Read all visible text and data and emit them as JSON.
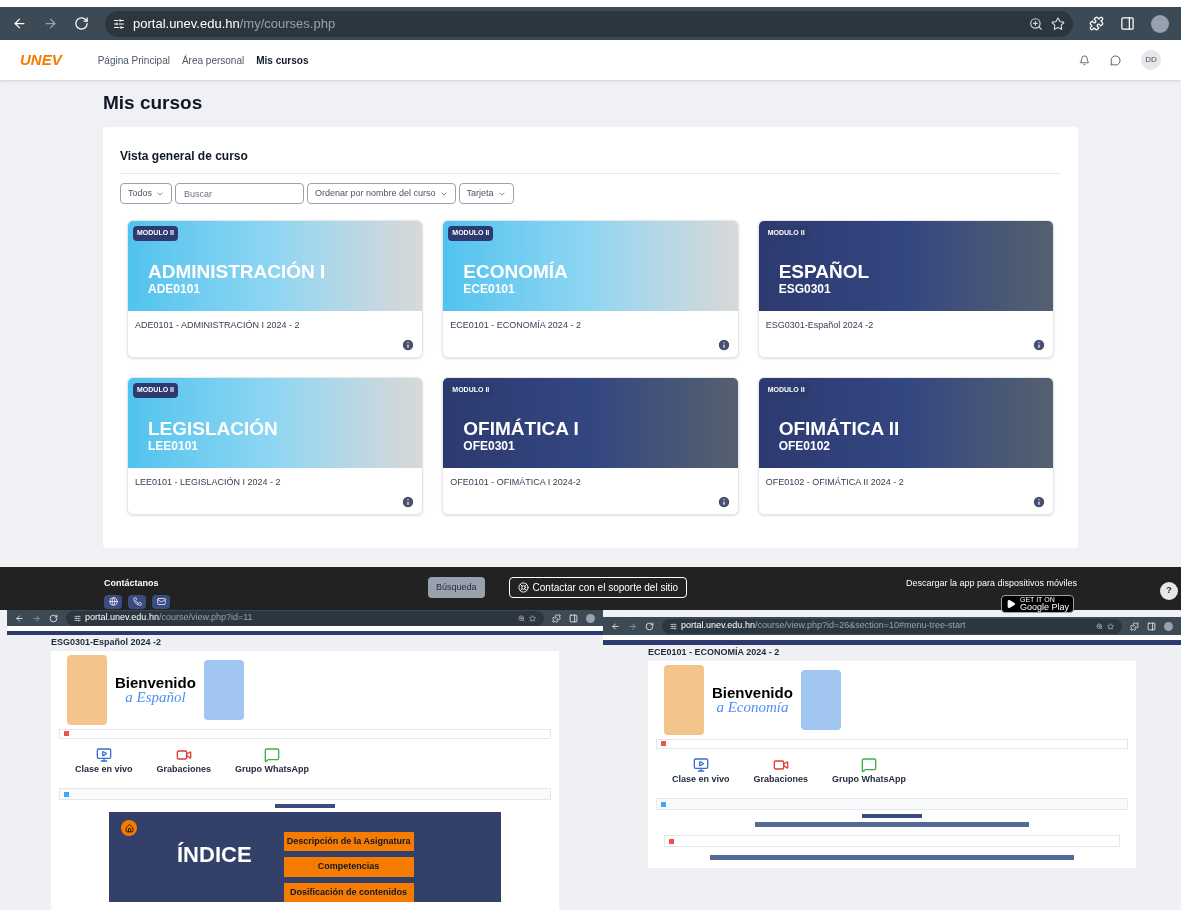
{
  "browser": {
    "url_host": "portal.unev.edu.hn",
    "url_path": "/my/courses.php"
  },
  "navbar": {
    "logo": "UNEV",
    "items": [
      {
        "label": "Página Principal",
        "selected": false
      },
      {
        "label": "Área personal",
        "selected": false
      },
      {
        "label": "Mis cursos",
        "selected": true
      }
    ],
    "avatar": "DD"
  },
  "page_title": "Mis cursos",
  "overview": {
    "title": "Vista general de curso",
    "filters": [
      {
        "kind": "dropdown",
        "label": "Todos"
      },
      {
        "kind": "search",
        "placeholder": "Buscar"
      },
      {
        "kind": "dropdown",
        "label": "Ordenar por nombre del curso"
      },
      {
        "kind": "dropdown",
        "label": "Tarjeta"
      }
    ],
    "courses": [
      {
        "badge": "MODULO II",
        "kind": "light",
        "title": "ADMINISTRACIÓN I",
        "code": "ADE0101",
        "name": "ADE0101 - ADMINISTRACIÓN I 2024 - 2"
      },
      {
        "badge": "MODULO II",
        "kind": "light",
        "title": "ECONOMÍA",
        "code": "ECE0101",
        "name": "ECE0101 - ECONOMÍA 2024 - 2"
      },
      {
        "badge": "MODULO II",
        "kind": "dark",
        "title": "ESPAÑOL",
        "code": "ESG0301",
        "name": "ESG0301-Español 2024 -2"
      },
      {
        "badge": "MODULO II",
        "kind": "light",
        "title": "LEGISLACIÓN",
        "code": "LEE0101",
        "name": "LEE0101 - LEGISLACIÓN I 2024 - 2"
      },
      {
        "badge": "MODULO II",
        "kind": "dark",
        "title": "OFIMÁTICA I",
        "code": "OFE0301",
        "name": "OFE0101 - OFIMÁTICA I 2024-2"
      },
      {
        "badge": "MODULO II",
        "kind": "dark",
        "title": "OFIMÁTICA II",
        "code": "OFE0102",
        "name": "OFE0102 - OFIMÁTICA II 2024 - 2"
      }
    ]
  },
  "footer": {
    "contact_title": "Contáctanos",
    "search_button": "Búsqueda",
    "support_button": "Contactar con el soporte del sitio",
    "app_title": "Descargar la app para dispositivos móviles",
    "store_small": "GET IT ON",
    "store_name": "Google Play",
    "help": "?"
  },
  "screenshots": [
    {
      "url_host": "portal.unev.edu.hn",
      "url_path": "/course/view.php?id=11",
      "heading": "ESG0301-Español 2024 -2",
      "welcome": "Bienvenido",
      "subject": "a Español",
      "shortcuts": [
        "Clase en vivo",
        "Grabaciones",
        "Grupo WhatsApp"
      ],
      "index": {
        "title": "ÍNDICE",
        "buttons": [
          "Descripción de la Asignatura",
          "Competencias",
          "Dosificación de contenidos"
        ]
      }
    },
    {
      "url_host": "portal.unev.edu.hn",
      "url_path": "/course/view.php?id=26&section=10#menu-tree-start",
      "heading": "ECE0101 - ECONOMÍA 2024 - 2",
      "welcome": "Bienvenido",
      "subject": "a Economía",
      "shortcuts": [
        "Clase en vivo",
        "Grabaciones",
        "Grupo WhatsApp"
      ]
    }
  ]
}
